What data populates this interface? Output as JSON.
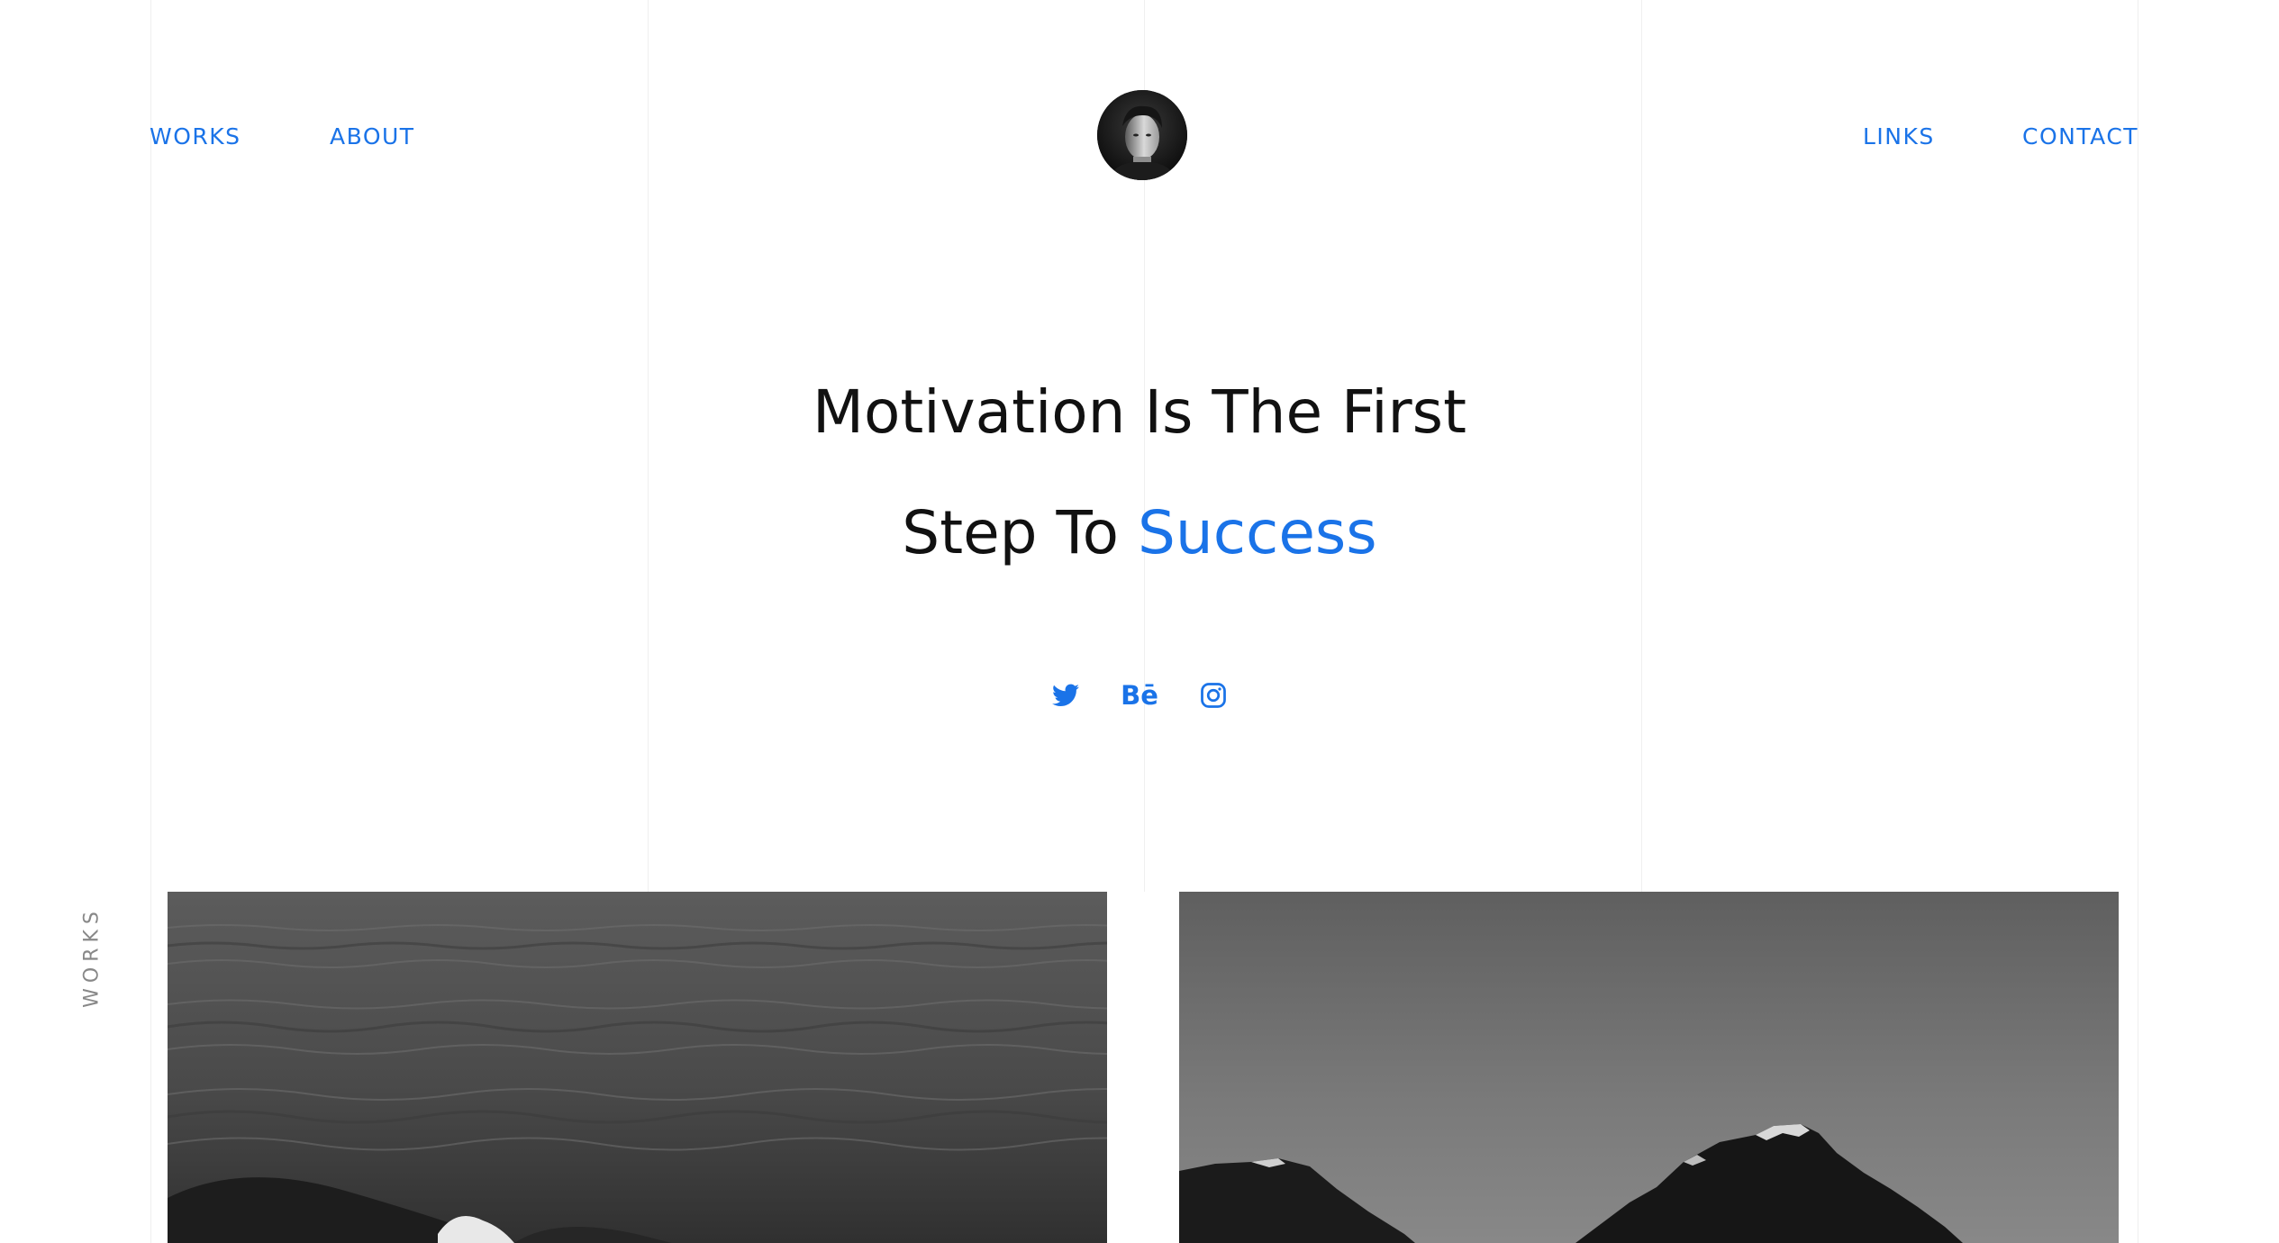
{
  "nav": {
    "left": [
      {
        "label": "WORKS"
      },
      {
        "label": "ABOUT"
      }
    ],
    "right": [
      {
        "label": "LINKS"
      },
      {
        "label": "CONTACT"
      }
    ]
  },
  "hero": {
    "line1": "Motivation Is The First",
    "line2_prefix": "Step To",
    "line2_accent": "Success"
  },
  "social": {
    "behance_text": "Bē",
    "icons": [
      "twitter-icon",
      "behance-icon",
      "instagram-icon"
    ]
  },
  "side_label": "WORKS",
  "colors": {
    "accent": "#1a73e8",
    "text": "#111111",
    "gridline": "#efefef",
    "side_label": "#888888"
  }
}
